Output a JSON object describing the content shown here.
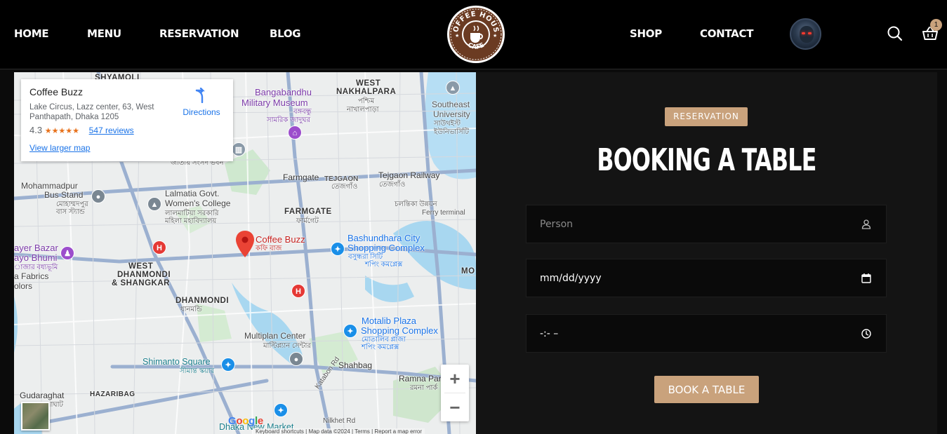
{
  "nav": {
    "left_links": [
      "HOME",
      "MENU",
      "RESERVATION",
      "BLOG"
    ],
    "right_links": [
      "SHOP",
      "CONTACT"
    ],
    "logo_text_top": "COFFEE HOUSE",
    "logo_text_bottom": "CAFE",
    "cart_count": "1"
  },
  "map": {
    "card": {
      "name": "Coffee Buzz",
      "address": "Lake Circus, Lazz center, 63, West Panthapath, Dhaka 1205",
      "rating": "4.3",
      "stars": "★★★★★",
      "reviews": "547 reviews",
      "directions": "Directions",
      "larger_map": "View larger map"
    },
    "labels": {
      "shyamoli": "SHYAMOLI",
      "west_nakhalpara": "WEST",
      "west_nakhalpara2": "NAKHALPARA",
      "nakhalpara_bn": "পশ্চিম",
      "nakhalpara_bn2": "নাখালপাড়া",
      "bangabandhu": "Bangabandhu",
      "military_museum": "Military Museum",
      "museum_bn": "বঙ্গবন্ধু",
      "museum_bn2": "সামরিক জাদুঘর",
      "southeast": "Southeast",
      "university": "University",
      "univ_bn": "সাউথইস্ট",
      "univ_bn2": "ইউনিভার্সিটি",
      "jatiya_bn": "জাতীয় সংসদ ভবন",
      "mohammadpur": "Mohammadpur",
      "bus_stand": "Bus Stand",
      "bus_stand_bn": "মোহাম্মদপুর",
      "bus_stand_bn2": "বাস স্ট্যান্ড",
      "farmgate": "Farmgate",
      "tejgaon": "TEJGAON",
      "tejgaon_bn": "তেজগাঁও",
      "tejgaon_railway": "Tejgaon Railway",
      "tejgaon_railway_bn": "তেজগাঁও",
      "ferry_bn": "চলন্তিকা উন্নয়ন",
      "ferry": "Ferry terminal",
      "lalmatia": "Lalmatia Govt.",
      "womens_college": "Women's College",
      "lalmatia_bn": "লালমাটিয়া সরকারি",
      "lalmatia_bn2": "মহিলা মহাবিদ্যালয়",
      "farmgate_caps": "FARMGATE",
      "farmgate_bn": "ফার্মগেট",
      "bashundhara": "Bashundhara City",
      "shopping_complex": "Shopping Complex",
      "bashundhara_bn": "বসুন্ধরা সিটি",
      "bashundhara_bn2": "শপিং কমপ্লেক্স",
      "coffee_buzz": "Coffee Buzz",
      "coffee_buzz_bn": "কফি বাজ",
      "ayer_bazar": "ayer Bazar",
      "ayo_bhumi": "ayo Bhumi",
      "ayer_bn": "াজার বধ্যভূমি",
      "fabrics": "a Fabrics",
      "olors": "olors",
      "west_dhanmondi": "WEST",
      "west_dhanmondi2": "DHANMONDI",
      "shangkar": "& SHANGKAR",
      "dhanmondi": "DHANMONDI",
      "dhanmondi_bn": "ধানমন্ডি",
      "motalib": "Motalib Plaza",
      "motalib_complex": "Shopping Complex",
      "motalib_bn": "মোতালিব প্লাজা",
      "motalib_bn2": "শপিং কমপ্লেক্স",
      "multiplan": "Multiplan Center",
      "multiplan_bn": "মাল্টিপ্ল্যান সেন্টার",
      "shimanto": "Shimanto Square",
      "shimanto_bn": "সীমান্ত স্কয়ার",
      "shahbag": "Shahbag",
      "ramna": "Ramna Park",
      "ramna_bn": "রমনা পার্ক",
      "gudaraghat": "Gudaraghat",
      "gudaraghat_bn": "গুদারাঘাট",
      "hazaribag": "HAZARIBAG",
      "katabon": "Katabon Rd",
      "nilkhet": "Nilkhet Rd",
      "dhaka_new_market": "Dhaka New Market",
      "mo": "MO"
    },
    "google": "Google",
    "attribution": "Keyboard shortcuts  |  Map data ©2024  |  Terms  |  Report a map error",
    "zoom_in": "+",
    "zoom_out": "−"
  },
  "booking": {
    "badge": "RESERVATION",
    "title": "BOOKING A TABLE",
    "person_placeholder": "Person",
    "date_value": "mm/dd/yyyy",
    "time_value": "-:- –",
    "button": "BOOK A TABLE"
  },
  "colors": {
    "accent": "#c9a27c",
    "nav_bg": "#000000",
    "panel_bg": "#141414",
    "map_pin": "#ea4335"
  }
}
